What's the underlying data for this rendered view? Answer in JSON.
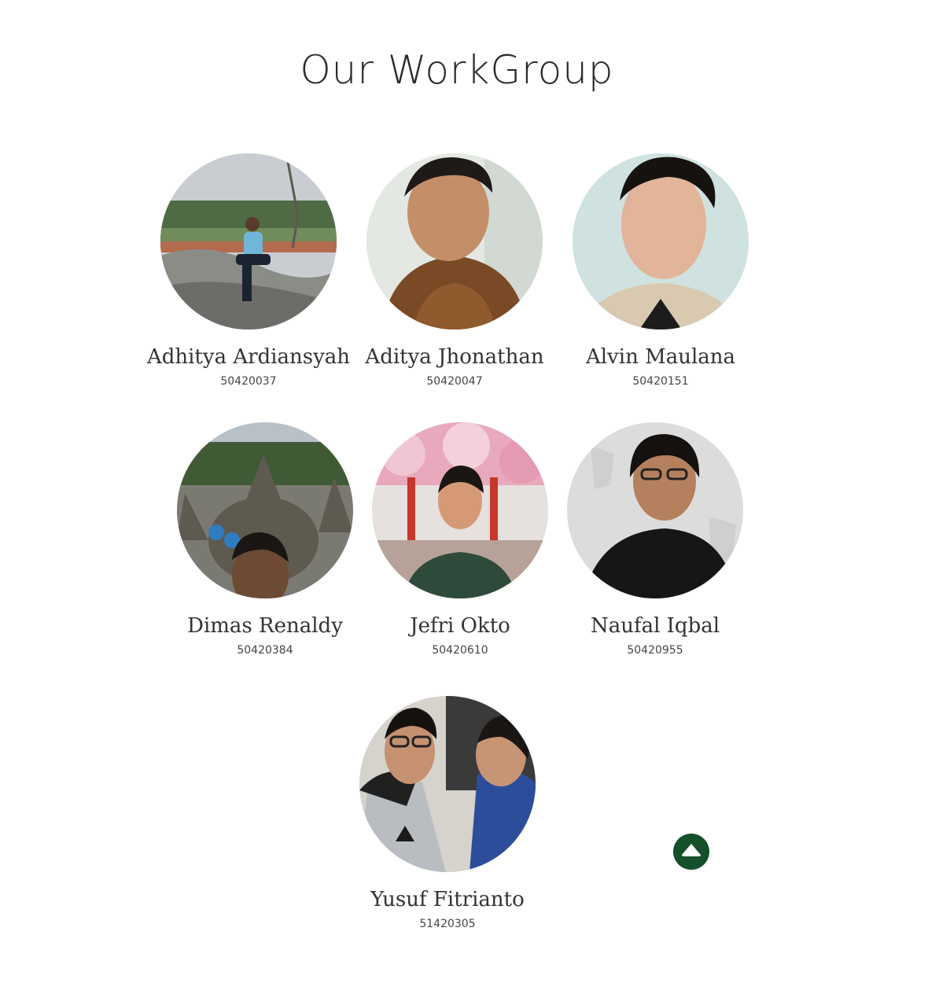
{
  "page": {
    "title": "Our WorkGroup"
  },
  "members": [
    {
      "name": "Adhitya Ardiansyah",
      "nim": "50420037"
    },
    {
      "name": "Aditya Jhonathan",
      "nim": "50420047"
    },
    {
      "name": "Alvin Maulana",
      "nim": "50420151"
    },
    {
      "name": "Dimas Renaldy",
      "nim": "50420384"
    },
    {
      "name": "Jefri Okto",
      "nim": "50420610"
    },
    {
      "name": "Naufal Iqbal",
      "nim": "50420955"
    },
    {
      "name": "Yusuf Fitrianto",
      "nim": "51420305"
    }
  ],
  "back_to_top": {
    "icon": "arrow-up-icon",
    "color": "#14502a"
  }
}
